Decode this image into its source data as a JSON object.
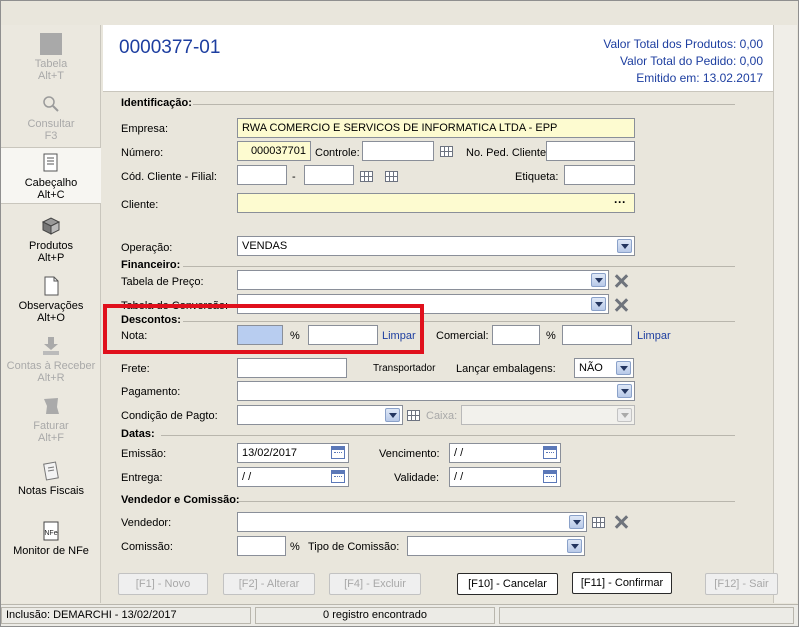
{
  "sidebar": {
    "items": [
      {
        "label": "Tabela",
        "shortcut": "Alt+T"
      },
      {
        "label": "Consultar",
        "shortcut": "F3"
      },
      {
        "label": "Cabeçalho",
        "shortcut": "Alt+C"
      },
      {
        "label": "Produtos",
        "shortcut": "Alt+P"
      },
      {
        "label": "Observações",
        "shortcut": "Alt+O"
      },
      {
        "label": "Contas à Receber",
        "shortcut": "Alt+R"
      },
      {
        "label": "Faturar",
        "shortcut": "Alt+F"
      },
      {
        "label": "Notas Fiscais",
        "shortcut": ""
      },
      {
        "label": "Monitor de NFe",
        "shortcut": ""
      }
    ]
  },
  "header": {
    "title": "0000377-01",
    "total_produtos": "Valor Total dos Produtos: 0,00",
    "total_pedido": "Valor Total do Pedido: 0,00",
    "emitido": "Emitido em: 13.02.2017"
  },
  "form": {
    "identificacao": {
      "section": "Identificação:",
      "empresa_label": "Empresa:",
      "empresa": "RWA COMERCIO E SERVICOS DE INFORMATICA LTDA - EPP",
      "numero_label": "Número:",
      "numero": "000037701",
      "controle_label": "Controle:",
      "controle": "",
      "ped_cliente_label": "No. Ped. Cliente:",
      "ped_cliente": "",
      "cod_cliente_label": "Cód. Cliente - Filial:",
      "cod_cliente": "",
      "filial": "",
      "dash": "-",
      "etiqueta_label": "Etiqueta:",
      "etiqueta": "",
      "cliente_label": "Cliente:",
      "cliente": "",
      "cliente_btn": "···"
    },
    "operacao_label": "Operação:",
    "operacao": "VENDAS",
    "financeiro": {
      "section": "Financeiro:",
      "tabela_preco_label": "Tabela de Preço:",
      "tabela_preco": "",
      "tabela_conversao_label": "Tabela de Conversão:",
      "tabela_conversao": ""
    },
    "descontos": {
      "section": "Descontos:",
      "nota_label": "Nota:",
      "nota_pct": "",
      "pct": "%",
      "nota_valor": "",
      "limpar": "Limpar",
      "comercial_label": "Comercial:",
      "comercial_pct": "",
      "comercial_valor": ""
    },
    "frete_label": "Frete:",
    "frete": "",
    "transportador": "Transportador",
    "lancar_label": "Lançar embalagens:",
    "lancar": "NÃO",
    "pagamento_label": "Pagamento:",
    "pagamento": "",
    "condicao_label": "Condição de Pagto:",
    "condicao": "",
    "caixa_label": "Caixa:",
    "caixa": "",
    "datas": {
      "section": "Datas:",
      "emissao_label": "Emissão:",
      "emissao": "13/02/2017",
      "vencimento_label": "Vencimento:",
      "vencimento": "/ /",
      "entrega_label": "Entrega:",
      "entrega": "/ /",
      "validade_label": "Validade:",
      "validade": "/ /"
    },
    "vendedor": {
      "section": "Vendedor e Comissão:",
      "vendedor_label": "Vendedor:",
      "vendedor": "",
      "comissao_label": "Comissão:",
      "comissao": "",
      "pct": "%",
      "tipo_label": "Tipo de Comissão:",
      "tipo": ""
    }
  },
  "buttons": {
    "novo": "[F1] - Novo",
    "alterar": "[F2] - Alterar",
    "excluir": "[F4] - Excluir",
    "cancelar": "[F10] - Cancelar",
    "confirmar": "[F11] - Confirmar",
    "sair": "[F12] - Sair"
  },
  "status": {
    "inclusao": "Inclusão: DEMARCHI - 13/02/2017",
    "registros": "0 registro encontrado"
  }
}
